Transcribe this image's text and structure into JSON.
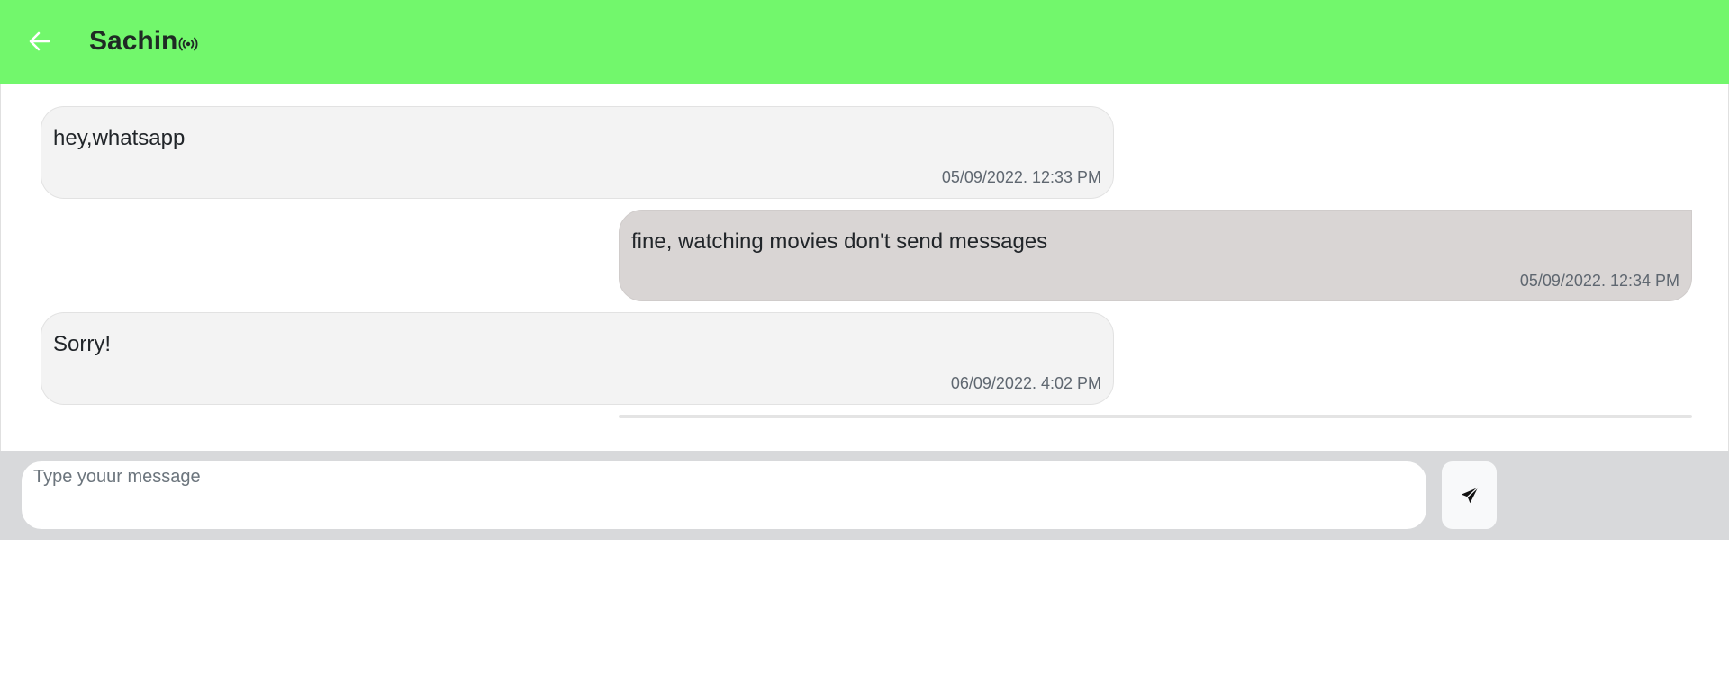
{
  "header": {
    "contact_name": "Sachin",
    "back_icon": "arrow-left-icon",
    "status_icon": "broadcast-icon",
    "background_color": "#72f76c"
  },
  "messages": [
    {
      "direction": "received",
      "text": "hey,whatsapp",
      "timestamp": "05/09/2022. 12:33 PM"
    },
    {
      "direction": "sent",
      "text": "fine, watching movies don't send messages",
      "timestamp": "05/09/2022. 12:34 PM"
    },
    {
      "direction": "received",
      "text": "Sorry!",
      "timestamp": "06/09/2022. 4:02 PM"
    }
  ],
  "composer": {
    "placeholder": "Type youur message",
    "value": "",
    "send_icon": "send-icon"
  },
  "colors": {
    "received_bubble": "#f3f3f3",
    "sent_bubble": "#d9d5d4",
    "composer_bar": "#d8d9db"
  }
}
